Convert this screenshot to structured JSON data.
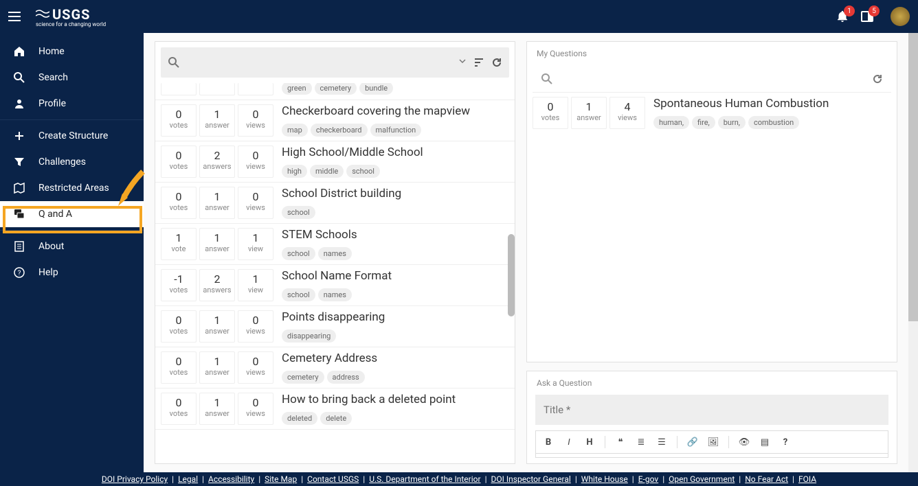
{
  "header": {
    "logo_main": "USGS",
    "logo_sub": "science for a changing world",
    "notif_badges": {
      "bell": "1",
      "panel": "5"
    }
  },
  "sidebar": {
    "items": [
      {
        "icon": "home",
        "label": "Home"
      },
      {
        "icon": "search",
        "label": "Search"
      },
      {
        "icon": "person",
        "label": "Profile"
      },
      {
        "icon": "plus",
        "label": "Create Structure"
      },
      {
        "icon": "filter",
        "label": "Challenges"
      },
      {
        "icon": "map",
        "label": "Restricted Areas"
      },
      {
        "icon": "qa",
        "label": "Q and A"
      },
      {
        "icon": "about",
        "label": "About"
      },
      {
        "icon": "help",
        "label": "Help"
      }
    ]
  },
  "questions": {
    "partial_tags": [
      "green",
      "cemetery",
      "bundle"
    ],
    "list": [
      {
        "votes": "0",
        "vl": "votes",
        "answers": "1",
        "al": "answer",
        "views": "0",
        "wl": "views",
        "title": "Checkerboard covering the mapview",
        "tags": [
          "map",
          "checkerboard",
          "malfunction"
        ]
      },
      {
        "votes": "0",
        "vl": "votes",
        "answers": "2",
        "al": "answers",
        "views": "0",
        "wl": "views",
        "title": "High School/Middle School",
        "tags": [
          "high",
          "middle",
          "school"
        ]
      },
      {
        "votes": "0",
        "vl": "votes",
        "answers": "1",
        "al": "answer",
        "views": "0",
        "wl": "views",
        "title": "School District building",
        "tags": [
          "school"
        ]
      },
      {
        "votes": "1",
        "vl": "vote",
        "answers": "1",
        "al": "answer",
        "views": "1",
        "wl": "view",
        "title": "STEM Schools",
        "tags": [
          "school",
          "names"
        ]
      },
      {
        "votes": "-1",
        "vl": "votes",
        "answers": "2",
        "al": "answers",
        "views": "1",
        "wl": "view",
        "title": "School Name Format",
        "tags": [
          "school",
          "names"
        ]
      },
      {
        "votes": "0",
        "vl": "votes",
        "answers": "1",
        "al": "answer",
        "views": "0",
        "wl": "views",
        "title": "Points disappearing",
        "tags": [
          "disappearing"
        ]
      },
      {
        "votes": "0",
        "vl": "votes",
        "answers": "1",
        "al": "answer",
        "views": "0",
        "wl": "views",
        "title": "Cemetery Address",
        "tags": [
          "cemetery",
          "address"
        ]
      },
      {
        "votes": "0",
        "vl": "votes",
        "answers": "1",
        "al": "answer",
        "views": "0",
        "wl": "views",
        "title": "How to bring back a deleted point",
        "tags": [
          "deleted",
          "delete"
        ]
      }
    ]
  },
  "myq": {
    "header": "My Questions",
    "item": {
      "votes": "0",
      "vl": "votes",
      "answers": "1",
      "al": "answer",
      "views": "4",
      "wl": "views",
      "title": "Spontaneous Human Combustion",
      "tags": [
        "human,",
        "fire,",
        "burn,",
        "combustion"
      ]
    }
  },
  "ask": {
    "header": "Ask a Question",
    "title_placeholder": "Title *"
  },
  "footer": [
    "DOI Privacy Policy",
    "Legal",
    "Accessibility",
    "Site Map",
    "Contact USGS",
    "U.S. Department of the Interior",
    "DOI Inspector General",
    "White House",
    "E-gov",
    "Open Government",
    "No Fear Act",
    "FOIA"
  ]
}
